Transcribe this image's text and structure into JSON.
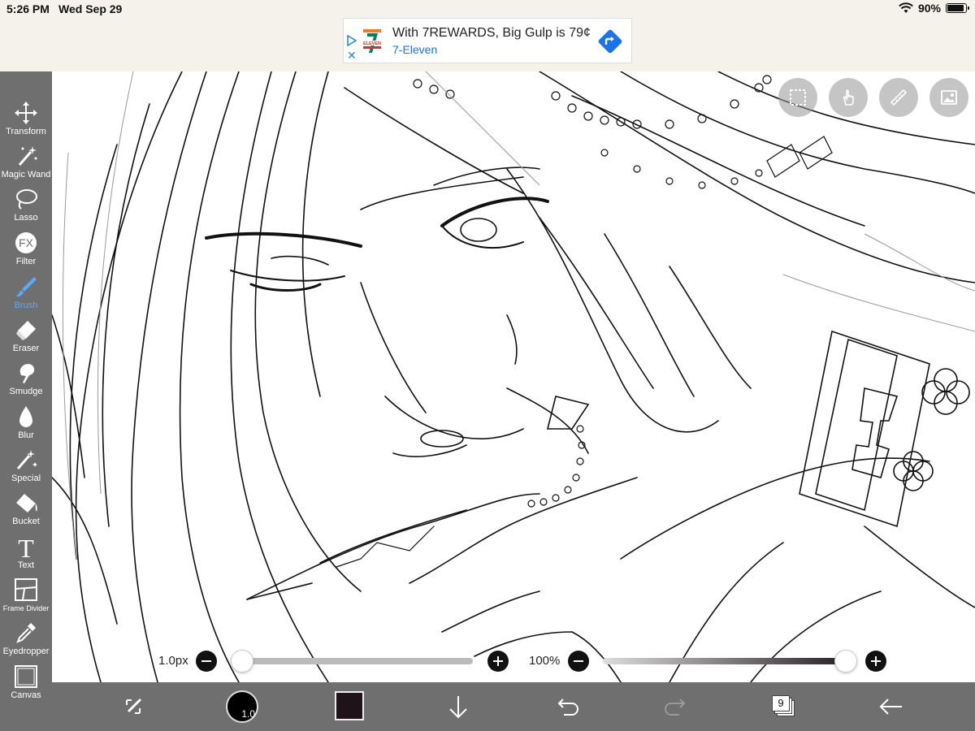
{
  "status_bar": {
    "time": "5:26 PM",
    "date": "Wed Sep 29",
    "battery_percent": "90%",
    "battery_level": 0.9
  },
  "ad": {
    "headline": "With 7REWARDS, Big Gulp is 79¢",
    "brand": "7-Eleven",
    "logo_text": "ELEVEN",
    "close_glyph": "✕",
    "brand_colors": {
      "orange": "#f47a20",
      "green": "#008163",
      "red": "#ee2722"
    }
  },
  "toolbar": {
    "items": [
      {
        "id": "transform",
        "label": "Transform",
        "icon": "move-arrows-icon"
      },
      {
        "id": "magic-wand",
        "label": "Magic Wand",
        "icon": "magic-wand-icon"
      },
      {
        "id": "lasso",
        "label": "Lasso",
        "icon": "lasso-icon"
      },
      {
        "id": "filter",
        "label": "Filter",
        "icon": "fx-icon",
        "glyph": "FX"
      },
      {
        "id": "brush",
        "label": "Brush",
        "icon": "brush-icon",
        "active": true
      },
      {
        "id": "eraser",
        "label": "Eraser",
        "icon": "eraser-icon"
      },
      {
        "id": "smudge",
        "label": "Smudge",
        "icon": "smudge-icon"
      },
      {
        "id": "blur",
        "label": "Blur",
        "icon": "droplet-icon"
      },
      {
        "id": "special",
        "label": "Special",
        "icon": "special-pen-icon"
      },
      {
        "id": "bucket",
        "label": "Bucket",
        "icon": "bucket-icon"
      },
      {
        "id": "text",
        "label": "Text",
        "icon": "text-icon",
        "glyph": "T"
      },
      {
        "id": "frame-divider",
        "label": "Frame Divider",
        "icon": "frame-divider-icon"
      },
      {
        "id": "eyedropper",
        "label": "Eyedropper",
        "icon": "eyedropper-icon"
      },
      {
        "id": "canvas",
        "label": "Canvas",
        "icon": "canvas-icon"
      }
    ],
    "active_color": "#5aa9ff"
  },
  "top_buttons": [
    {
      "id": "selection",
      "icon": "selection-icon"
    },
    {
      "id": "gesture",
      "icon": "hand-pointer-icon"
    },
    {
      "id": "ruler",
      "icon": "ruler-icon"
    },
    {
      "id": "reference",
      "icon": "image-icon"
    }
  ],
  "brush_size": {
    "value_label": "1.0px",
    "level": 0.0
  },
  "opacity": {
    "value_label": "100%",
    "level": 1.0
  },
  "bottom_bar": {
    "brush_indicator_label": "1.0",
    "current_color": "#1f1218",
    "layer_count": "9"
  },
  "colors": {
    "toolbar_bg": "#6f6f6f",
    "canvas_bg": "#ffffff",
    "status_bg": "#f4f2ea"
  }
}
